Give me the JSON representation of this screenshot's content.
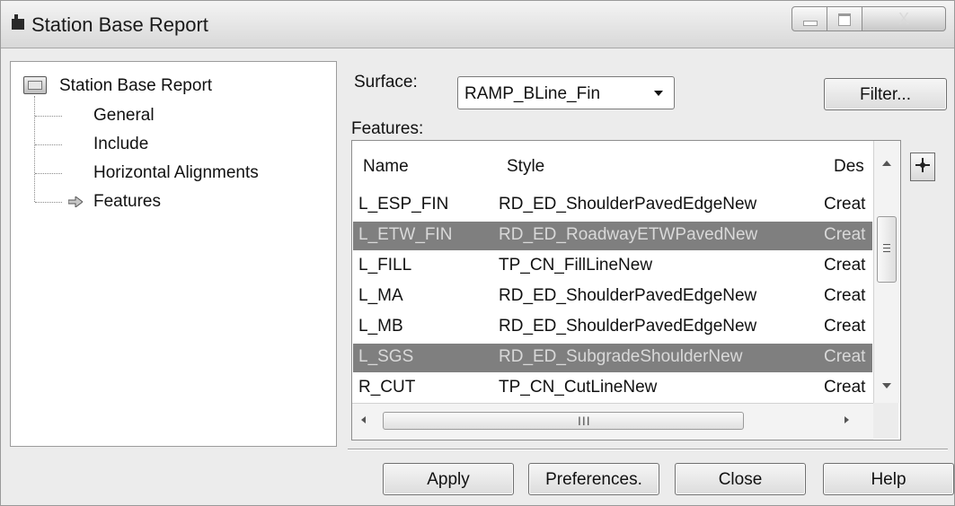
{
  "window": {
    "title": "Station Base Report",
    "close_glyph": "X"
  },
  "tree": {
    "root": "Station Base Report",
    "items": [
      {
        "label": "General"
      },
      {
        "label": "Include"
      },
      {
        "label": "Horizontal Alignments"
      },
      {
        "label": "Features",
        "selected": true
      }
    ]
  },
  "surface": {
    "label": "Surface:",
    "value": "RAMP_BLine_Fin"
  },
  "filter_button": "Filter...",
  "features": {
    "label": "Features:",
    "columns": [
      "Name",
      "Style",
      "Des"
    ],
    "rows": [
      {
        "name": "L_ESP_FIN",
        "style": "RD_ED_ShoulderPavedEdgeNew",
        "desc": "Creat",
        "selected": false
      },
      {
        "name": "L_ETW_FIN",
        "style": "RD_ED_RoadwayETWPavedNew",
        "desc": "Creat",
        "selected": true
      },
      {
        "name": "L_FILL",
        "style": "TP_CN_FillLineNew",
        "desc": "Creat",
        "selected": false
      },
      {
        "name": "L_MA",
        "style": "RD_ED_ShoulderPavedEdgeNew",
        "desc": "Creat",
        "selected": false
      },
      {
        "name": "L_MB",
        "style": "RD_ED_ShoulderPavedEdgeNew",
        "desc": "Creat",
        "selected": false
      },
      {
        "name": "L_SGS",
        "style": "RD_ED_SubgradeShoulderNew",
        "desc": "Creat",
        "selected": true
      },
      {
        "name": "R_CUT",
        "style": "TP_CN_CutLineNew",
        "desc": "Creat",
        "selected": false
      }
    ],
    "hscroll_grip": "III"
  },
  "buttons": {
    "apply": "Apply",
    "preferences": "Preferences.",
    "close": "Close",
    "help": "Help"
  },
  "colors": {
    "selection": "#7f7f7f",
    "dialog_bg": "#ececec"
  }
}
